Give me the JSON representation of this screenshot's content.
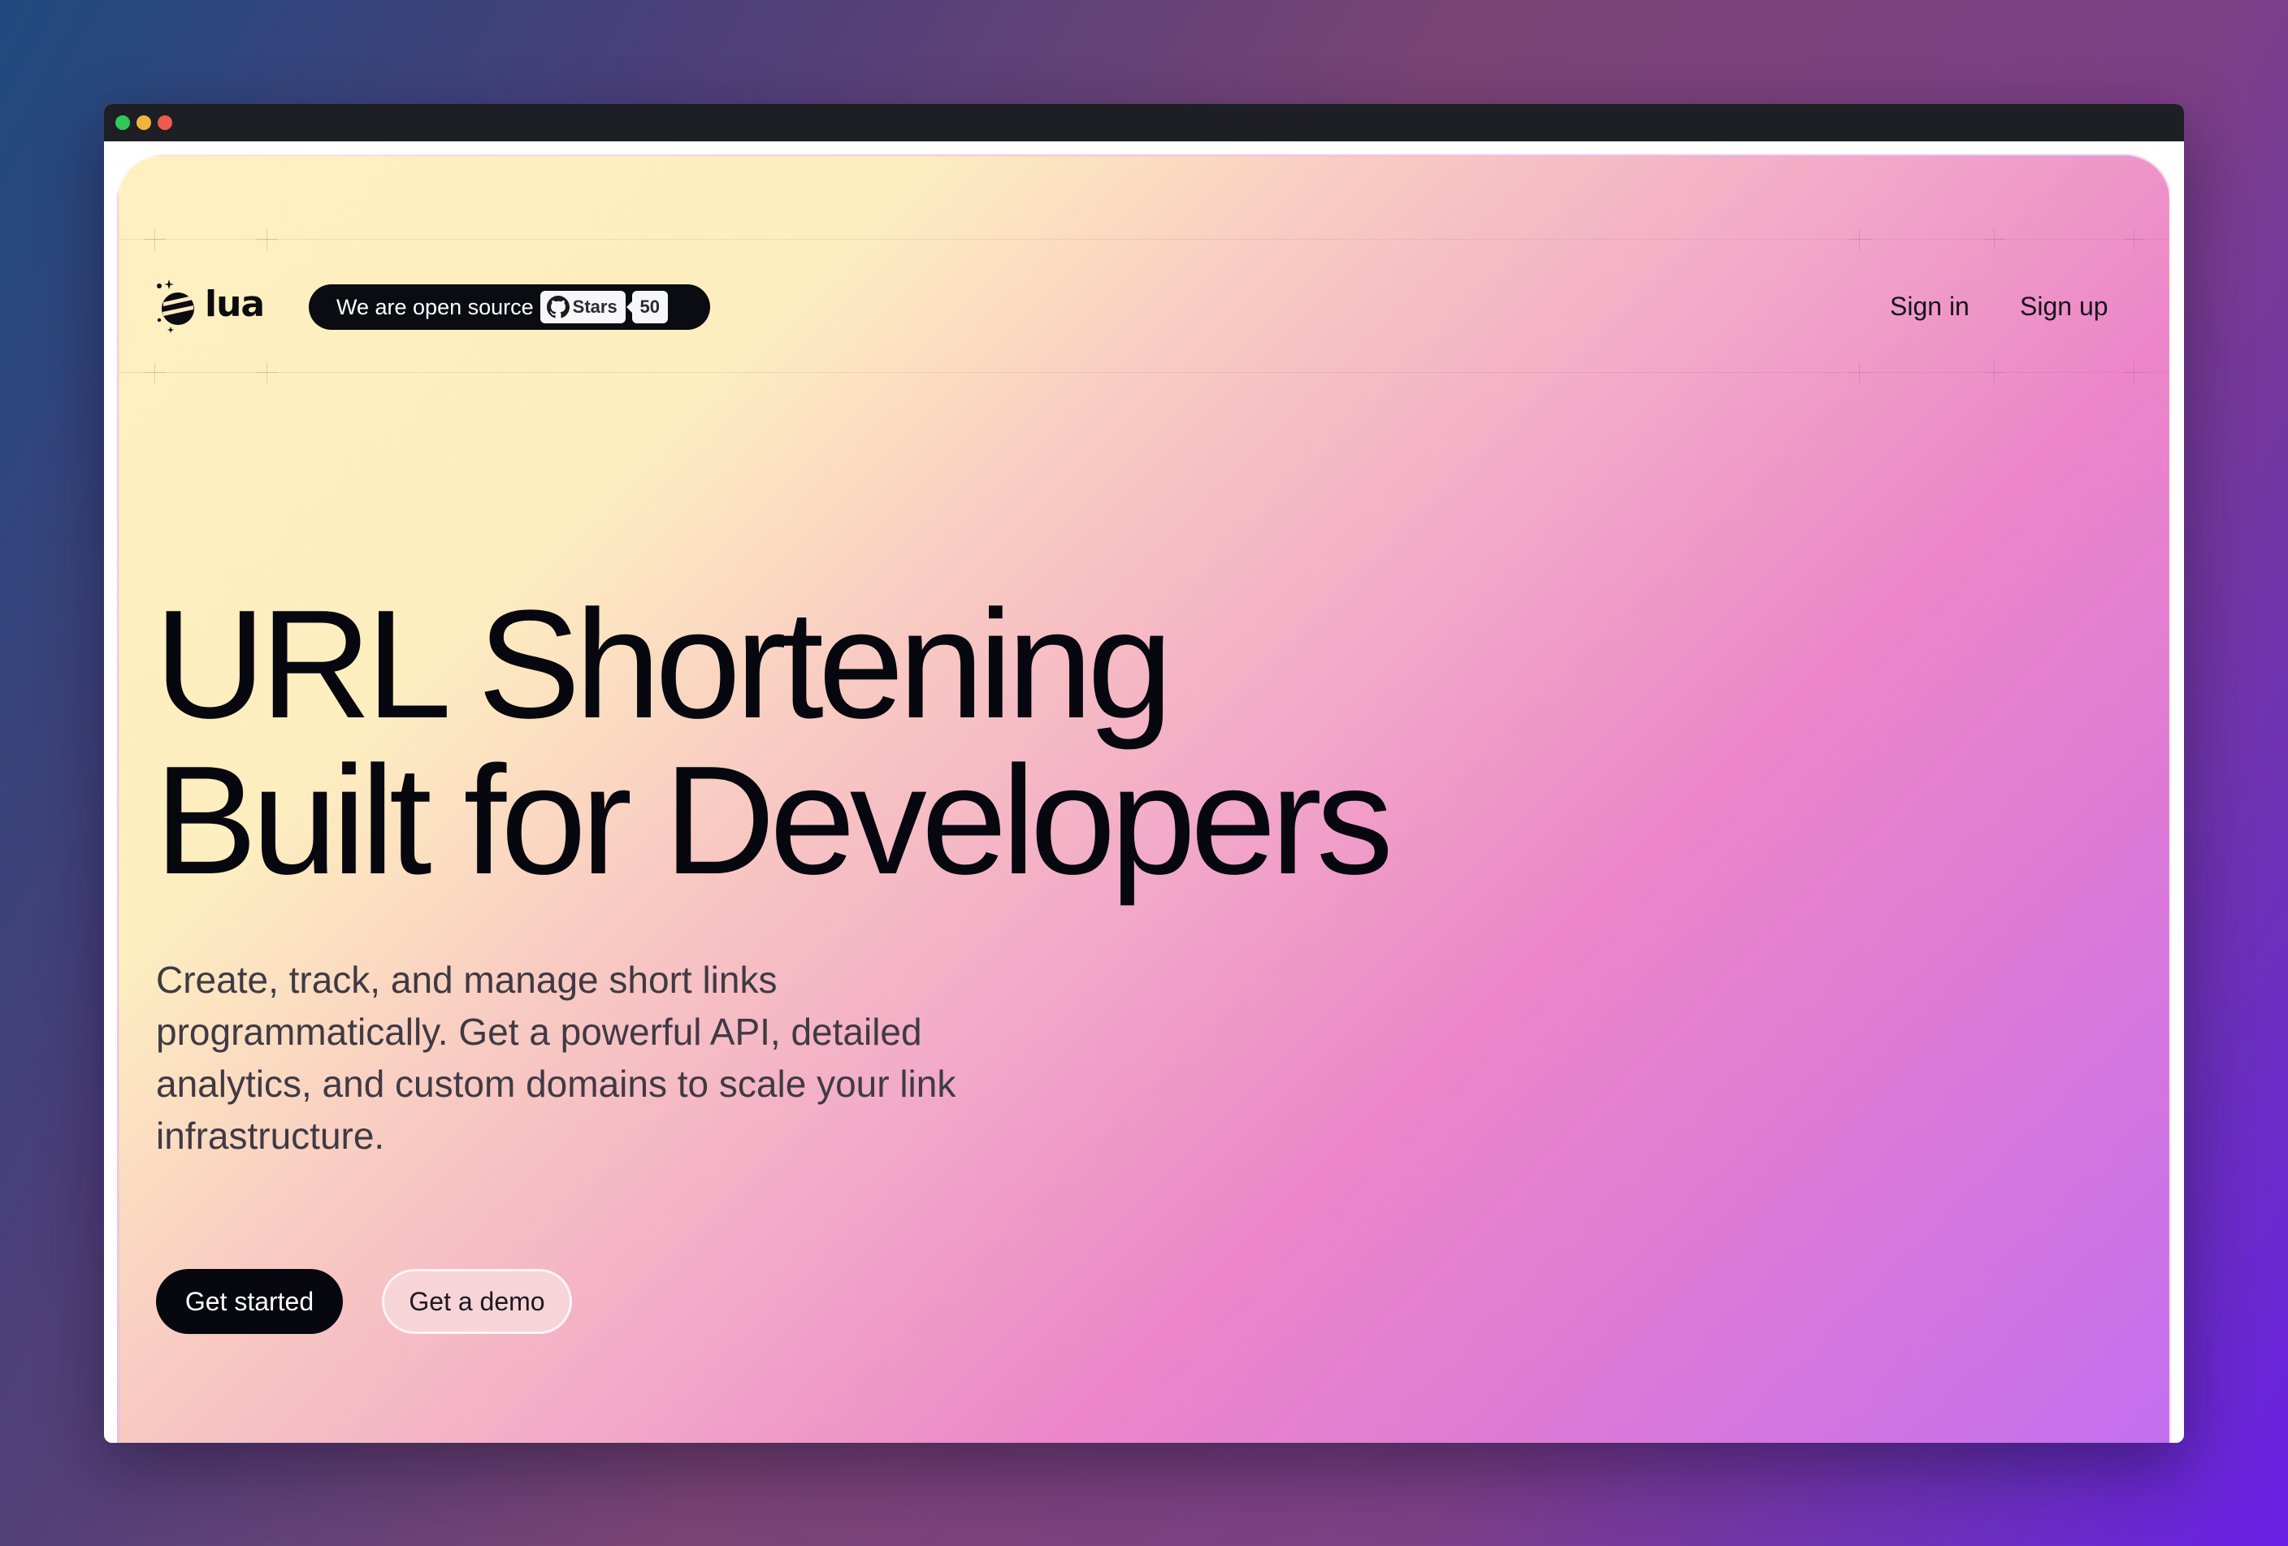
{
  "window": {
    "controls": [
      "green",
      "yellow",
      "red"
    ]
  },
  "nav": {
    "logo_text": "lua",
    "badge": {
      "text": "We are open source",
      "stars_label": "Stars",
      "stars_count": "50",
      "icon": "github-icon"
    },
    "sign_in": "Sign in",
    "sign_up": "Sign up"
  },
  "hero": {
    "headline_line1": "URL Shortening",
    "headline_line2": "Built for Developers",
    "subtitle": "Create, track, and manage short links programmatically. Get a powerful API, detailed analytics, and custom domains to scale your link infrastructure.",
    "primary_cta": "Get started",
    "secondary_cta": "Get a demo"
  },
  "colors": {
    "dark": "#07080f",
    "gradient_start": "#fef0c0",
    "gradient_mid": "#ec86c9",
    "gradient_end": "#c16ef0"
  }
}
